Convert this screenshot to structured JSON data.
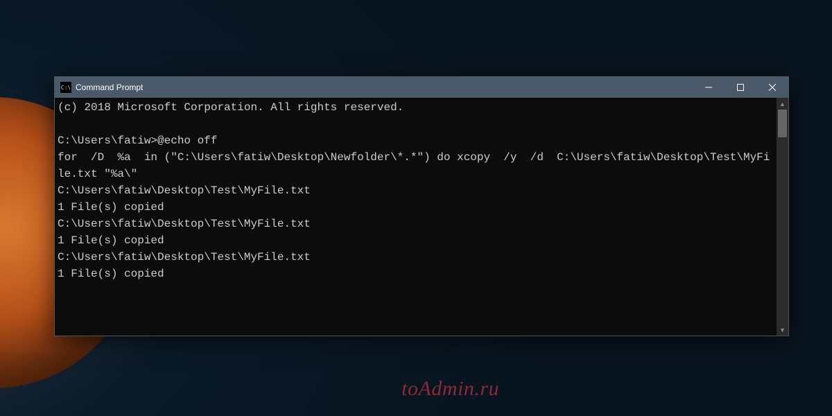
{
  "window": {
    "title": "Command Prompt",
    "icon_glyph": "C:\\"
  },
  "console": {
    "lines": [
      "(c) 2018 Microsoft Corporation. All rights reserved.",
      "",
      "C:\\Users\\fatiw>@echo off",
      "for  /D  %a  in (\"C:\\Users\\fatiw\\Desktop\\Newfolder\\*.*\") do xcopy  /y  /d  C:\\Users\\fatiw\\Desktop\\Test\\MyFile.txt \"%a\\\"",
      "C:\\Users\\fatiw\\Desktop\\Test\\MyFile.txt",
      "1 File(s) copied",
      "C:\\Users\\fatiw\\Desktop\\Test\\MyFile.txt",
      "1 File(s) copied",
      "C:\\Users\\fatiw\\Desktop\\Test\\MyFile.txt",
      "1 File(s) copied"
    ]
  },
  "watermark": "toAdmin.ru"
}
